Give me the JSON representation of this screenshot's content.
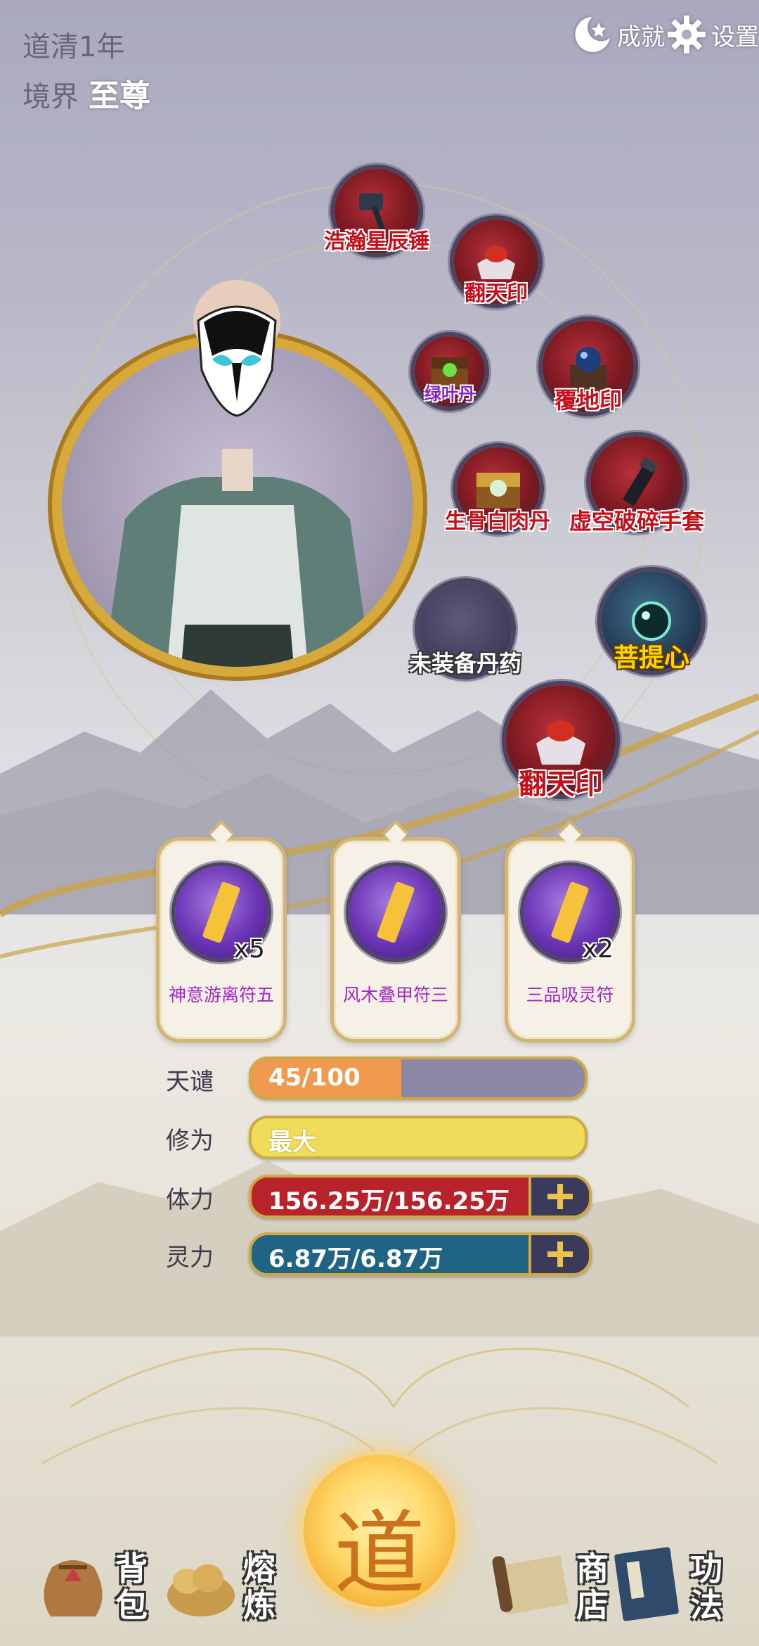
{
  "header": {
    "year_label": "道清1年",
    "realm_label": "境界",
    "realm_value": "至尊",
    "achievements_label": "成就",
    "settings_label": "设置"
  },
  "equipment": {
    "hammer": "浩瀚星辰锤",
    "seal_top": "翻天印",
    "pill_green": "绿叶丹",
    "earth_seal": "覆地印",
    "pill_bone": "生骨白肉丹",
    "glove": "虚空破碎手套",
    "empty_pill_slot": "未装备丹药",
    "bodhi": "菩提心",
    "seal_bottom": "翻天印"
  },
  "talismans": [
    {
      "name": "神意游离符五",
      "count": "x5"
    },
    {
      "name": "风木叠甲符三",
      "count": ""
    },
    {
      "name": "三品吸灵符",
      "count": "x2"
    }
  ],
  "stats": {
    "tribulation": {
      "label": "天谴",
      "value": "45/100",
      "fraction": 0.45
    },
    "cultivation": {
      "label": "修为",
      "value": "最大",
      "fraction": 1.0
    },
    "stamina": {
      "label": "体力",
      "value": "156.25万/156.25万",
      "fraction": 1.0
    },
    "spirit": {
      "label": "灵力",
      "value": "6.87万/6.87万",
      "fraction": 1.0
    }
  },
  "nav": {
    "bag": "背包",
    "smelt": "熔炼",
    "dao": "道",
    "shop": "商店",
    "skills": "功法"
  },
  "colors": {
    "tribulation_fill": "#ef9a4f",
    "tribulation_track": "#8c88a8",
    "cultivation_fill": "#eedc5a",
    "stamina_fill": "#b8222a",
    "spirit_fill": "#1f6485",
    "gold_border": "#cfa945",
    "item_name_red": "#c4101a",
    "item_name_purple": "#8a1fc7",
    "talisman_name": "#a226c9"
  },
  "icons": [
    "achievement-icon",
    "settings-icon",
    "hammer-icon",
    "seal-icon",
    "chest-pill-icon",
    "orb-altar-icon",
    "glove-icon",
    "bodhi-orb-icon",
    "talisman-icon",
    "plus-icon",
    "bag-icon",
    "smelt-icon",
    "scroll-icon",
    "book-icon"
  ]
}
